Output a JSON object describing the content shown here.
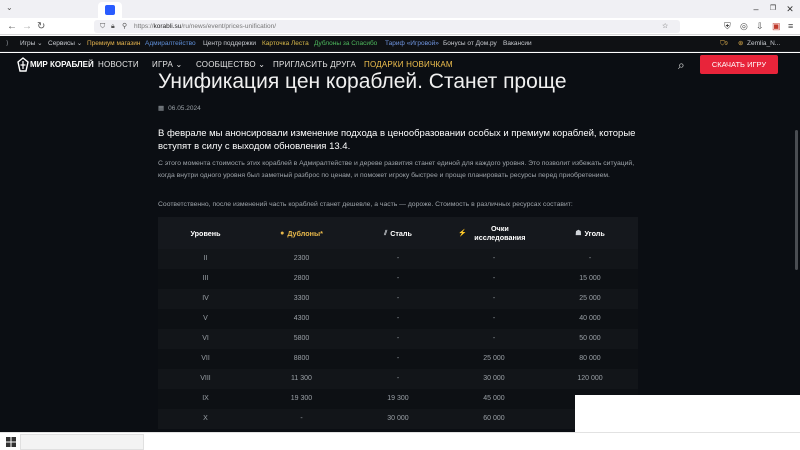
{
  "browser": {
    "tab_subtitle": "",
    "url_scheme": "https://",
    "url_host": "korabli.su",
    "url_path": "/ru/news/event/prices-unification/"
  },
  "topbar": {
    "left": [
      {
        "label": "Игры",
        "color": "#c9ccd1",
        "arrow": true
      },
      {
        "label": "Сервисы",
        "color": "#c9ccd1",
        "arrow": true
      },
      {
        "label": "Премиум магазин",
        "color": "#e6b44e"
      },
      {
        "label": "Адмиралтейство",
        "color": "#5f8fd8"
      },
      {
        "label": "Центр поддержки",
        "color": "#c9ccd1"
      },
      {
        "label": "Карточка Леста",
        "color": "#d8b94a"
      },
      {
        "label": "Дублоны за Спасибо",
        "color": "#4db85c"
      },
      {
        "label": "Тариф «Игровой»",
        "color": "#6f95e0"
      },
      {
        "label": "Бонусы от Дом.ру",
        "color": "#c9ccd1"
      },
      {
        "label": "Вакансии",
        "color": "#c9ccd1"
      }
    ],
    "badge_count": "9",
    "user": "Zemlia_N..."
  },
  "header": {
    "logo_text": "МИР КОРАБЛЕЙ",
    "nav": [
      {
        "label": "НОВОСТИ",
        "arrow": false,
        "color": "#e6e6e6"
      },
      {
        "label": "ИГРА",
        "arrow": true,
        "color": "#e6e6e6"
      },
      {
        "label": "СООБЩЕСТВО",
        "arrow": true,
        "color": "#e6e6e6"
      },
      {
        "label": "ПРИГЛАСИТЬ ДРУГА",
        "arrow": false,
        "color": "#e6e6e6"
      },
      {
        "label": "ПОДАРКИ НОВИЧКАМ",
        "arrow": false,
        "color": "#f2c14e"
      }
    ],
    "download": "СКАЧАТЬ ИГРУ"
  },
  "article": {
    "title": "Унификация цен кораблей. Станет проще",
    "date": "06.05.2024",
    "lead": "В феврале мы анонсировали изменение подхода в ценообразовании особых и премиум кораблей, которые вступят в силу с выходом обновления 13.4.",
    "para1": "С этого момента стоимость этих кораблей в Адмиралтействе и дереве развития станет единой для каждого уровня. Это позволит избежать ситуаций, когда внутри одного уровня был заметный разброс по ценам, и поможет игроку быстрее и проще планировать ресурсы перед приобретением.",
    "para2": "Соответственно, после изменений часть кораблей станет дешевле, а часть — дороже. Стоимость в различных ресурсах составит:"
  },
  "table": {
    "headers": [
      {
        "label": "Уровень",
        "icon": ""
      },
      {
        "label": "Дублоны*",
        "icon": "doubloon"
      },
      {
        "label": "Сталь",
        "icon": "steel"
      },
      {
        "label": "Очки исследования",
        "icon": "research"
      },
      {
        "label": "Уголь",
        "icon": "coal"
      }
    ],
    "rows": [
      [
        "II",
        "2300",
        "-",
        "-",
        "-"
      ],
      [
        "III",
        "2800",
        "-",
        "-",
        "15 000"
      ],
      [
        "IV",
        "3300",
        "-",
        "-",
        "25 000"
      ],
      [
        "V",
        "4300",
        "-",
        "-",
        "40 000"
      ],
      [
        "VI",
        "5800",
        "-",
        "-",
        "50 000"
      ],
      [
        "VII",
        "8800",
        "-",
        "25 000",
        "80 000"
      ],
      [
        "VIII",
        "11 300",
        "-",
        "30 000",
        "120 000"
      ],
      [
        "IX",
        "19 300",
        "19 300",
        "45 000",
        ""
      ],
      [
        "X",
        "-",
        "30 000",
        "60 000",
        ""
      ]
    ]
  }
}
